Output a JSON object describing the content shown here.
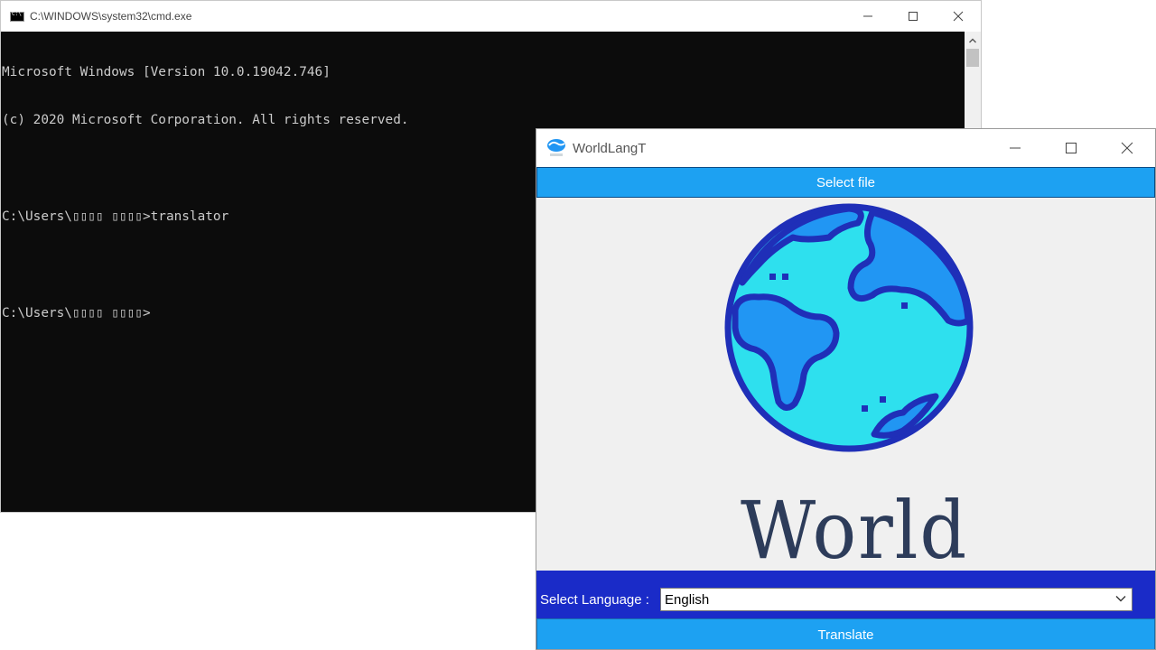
{
  "cmd": {
    "title": "C:\\WINDOWS\\system32\\cmd.exe",
    "console_lines": [
      "Microsoft Windows [Version 10.0.19042.746]",
      "(c) 2020 Microsoft Corporation. All rights reserved.",
      "",
      "C:\\Users\\▯▯▯▯ ▯▯▯▯>translator",
      "",
      "C:\\Users\\▯▯▯▯ ▯▯▯▯>"
    ]
  },
  "worldlang": {
    "title": "WorldLangT",
    "select_file_label": "Select file",
    "banner_text": "World",
    "language_label": "Select Language :",
    "language_value": "English",
    "translate_label": "Translate",
    "colors": {
      "button_blue": "#1da1f2",
      "lang_bar": "#1a2bc8",
      "globe_ocean": "#2ee0ee",
      "globe_land": "#2196f3",
      "globe_outline": "#1f2fb8"
    }
  },
  "icons": {
    "cmd_icon": "console-icon",
    "minimize": "minimize-icon",
    "maximize": "maximize-icon",
    "close": "close-icon",
    "dropdown": "chevron-down-icon",
    "globe": "globe-icon"
  }
}
